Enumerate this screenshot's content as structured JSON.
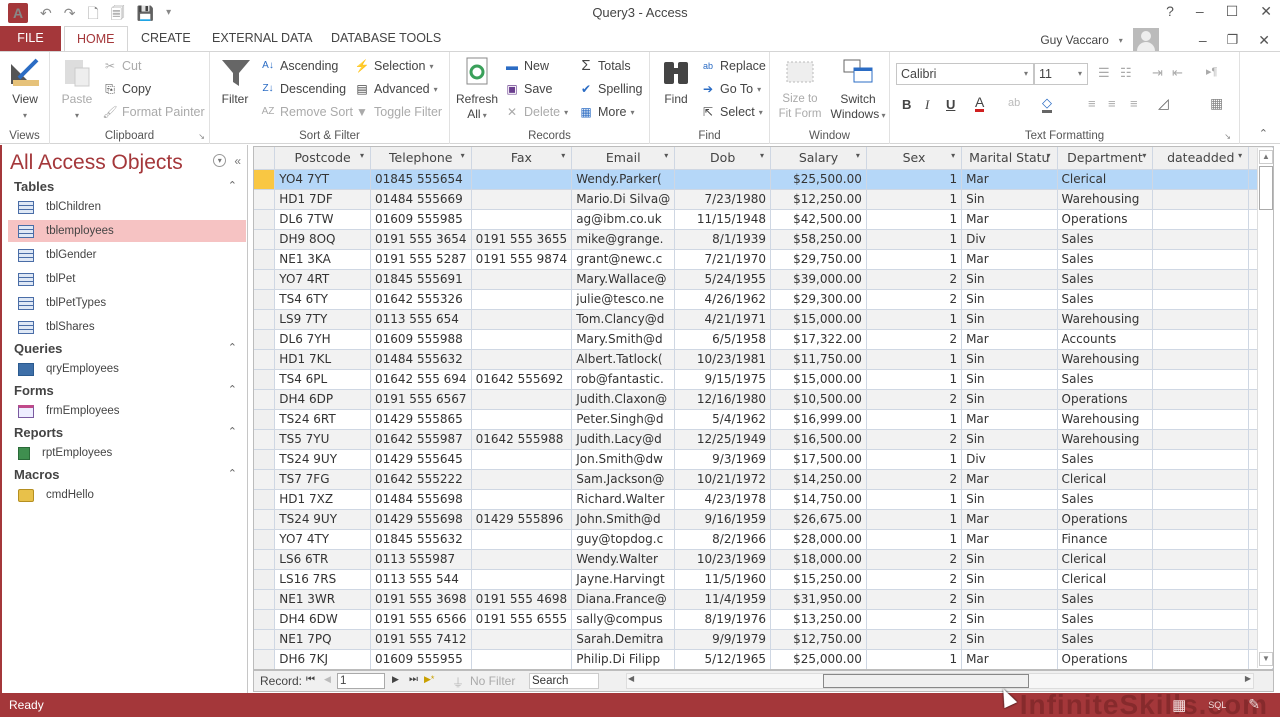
{
  "window": {
    "title": "Query3 - Access",
    "help": "?",
    "minimize": "–",
    "maximize": "☐",
    "close": "✕",
    "restore": "❐"
  },
  "qat": {
    "app_icon": "A",
    "undo": "↶",
    "redo": "↷",
    "print_preview": "🗋",
    "refresh": "🗐",
    "save": "💾",
    "customize": "▾"
  },
  "tabs": [
    {
      "label": "FILE"
    },
    {
      "label": "HOME"
    },
    {
      "label": "CREATE"
    },
    {
      "label": "EXTERNAL DATA"
    },
    {
      "label": "DATABASE TOOLS"
    }
  ],
  "user": {
    "name": "Guy Vaccaro",
    "caret": "▾"
  },
  "ribbon": {
    "views": {
      "label": "Views",
      "view": "View"
    },
    "clipboard": {
      "label": "Clipboard",
      "paste": "Paste",
      "cut": "Cut",
      "copy": "Copy",
      "format_painter": "Format Painter"
    },
    "sort_filter": {
      "label": "Sort & Filter",
      "filter": "Filter",
      "ascending": "Ascending",
      "descending": "Descending",
      "remove_sort": "Remove Sort",
      "selection": "Selection",
      "advanced": "Advanced",
      "toggle_filter": "Toggle Filter"
    },
    "records": {
      "label": "Records",
      "refresh": "Refresh",
      "refresh_all": "All",
      "new": "New",
      "save": "Save",
      "delete": "Delete",
      "totals": "Totals",
      "spelling": "Spelling",
      "more": "More"
    },
    "find": {
      "label": "Find",
      "find": "Find",
      "replace": "Replace",
      "goto": "Go To",
      "select": "Select"
    },
    "window": {
      "label": "Window",
      "size_to": "Size to",
      "fit_form": "Fit Form",
      "switch": "Switch",
      "windows": "Windows"
    },
    "text_formatting": {
      "label": "Text Formatting",
      "font": "Calibri",
      "size": "11",
      "bold": "B",
      "italic": "I",
      "underline": "U"
    }
  },
  "nav": {
    "title": "All Access Objects",
    "sections": [
      {
        "label": "Tables",
        "items": [
          "tblChildren",
          "tblemployees",
          "tblGender",
          "tblPet",
          "tblPetTypes",
          "tblShares"
        ]
      },
      {
        "label": "Queries",
        "items": [
          "qryEmployees"
        ]
      },
      {
        "label": "Forms",
        "items": [
          "frmEmployees"
        ]
      },
      {
        "label": "Reports",
        "items": [
          "rptEmployees"
        ]
      },
      {
        "label": "Macros",
        "items": [
          "cmdHello"
        ]
      }
    ],
    "selected": "tblemployees"
  },
  "table": {
    "columns": [
      "Postcode",
      "Telephone",
      "Fax",
      "Email",
      "Dob",
      "Salary",
      "Sex",
      "Marital Statu",
      "Department",
      "dateadded"
    ],
    "rows": [
      [
        "YO4 7YT",
        "01845 555654",
        "",
        "Wendy.Parker(",
        "",
        "$25,500.00",
        "1",
        "Mar",
        "Clerical",
        ""
      ],
      [
        "HD1 7DF",
        "01484 555669",
        "",
        "Mario.Di Silva@",
        "7/23/1980",
        "$12,250.00",
        "1",
        "Sin",
        "Warehousing",
        ""
      ],
      [
        "DL6 7TW",
        "01609 555985",
        "",
        "ag@ibm.co.uk",
        "11/15/1948",
        "$42,500.00",
        "1",
        "Mar",
        "Operations",
        ""
      ],
      [
        "DH9 8OQ",
        "0191 555 3654",
        "0191 555 3655",
        "mike@grange.",
        "8/1/1939",
        "$58,250.00",
        "1",
        "Div",
        "Sales",
        ""
      ],
      [
        "NE1 3KA",
        "0191 555 5287",
        "0191 555 9874",
        "grant@newc.c",
        "7/21/1970",
        "$29,750.00",
        "1",
        "Mar",
        "Sales",
        ""
      ],
      [
        "YO7 4RT",
        "01845 555691",
        "",
        "Mary.Wallace@",
        "5/24/1955",
        "$39,000.00",
        "2",
        "Sin",
        "Sales",
        ""
      ],
      [
        "TS4 6TY",
        "01642 555326",
        "",
        "julie@tesco.ne",
        "4/26/1962",
        "$29,300.00",
        "2",
        "Sin",
        "Sales",
        ""
      ],
      [
        "LS9 7TY",
        "0113 555 654",
        "",
        "Tom.Clancy@d",
        "4/21/1971",
        "$15,000.00",
        "1",
        "Sin",
        "Warehousing",
        ""
      ],
      [
        "DL6 7YH",
        "01609 555988",
        "",
        "Mary.Smith@d",
        "6/5/1958",
        "$17,322.00",
        "2",
        "Mar",
        "Accounts",
        ""
      ],
      [
        "HD1 7KL",
        "01484 555632",
        "",
        "Albert.Tatlock(",
        "10/23/1981",
        "$11,750.00",
        "1",
        "Sin",
        "Warehousing",
        ""
      ],
      [
        "TS4 6PL",
        "01642 555 694",
        "01642 555692",
        "rob@fantastic.",
        "9/15/1975",
        "$15,000.00",
        "1",
        "Sin",
        "Sales",
        ""
      ],
      [
        "DH4 6DP",
        "0191 555 6567",
        "",
        "Judith.Claxon@",
        "12/16/1980",
        "$10,500.00",
        "2",
        "Sin",
        "Operations",
        ""
      ],
      [
        "TS24 6RT",
        "01429 555865",
        "",
        "Peter.Singh@d",
        "5/4/1962",
        "$16,999.00",
        "1",
        "Mar",
        "Warehousing",
        ""
      ],
      [
        "TS5 7YU",
        "01642 555987",
        "01642 555988",
        "Judith.Lacy@d",
        "12/25/1949",
        "$16,500.00",
        "2",
        "Sin",
        "Warehousing",
        ""
      ],
      [
        "TS24 9UY",
        "01429 555645",
        "",
        "Jon.Smith@dw",
        "9/3/1969",
        "$17,500.00",
        "1",
        "Div",
        "Sales",
        ""
      ],
      [
        "TS7 7FG",
        "01642 555222",
        "",
        "Sam.Jackson@",
        "10/21/1972",
        "$14,250.00",
        "2",
        "Mar",
        "Clerical",
        ""
      ],
      [
        "HD1 7XZ",
        "01484 555698",
        "",
        "Richard.Walter",
        "4/23/1978",
        "$14,750.00",
        "1",
        "Sin",
        "Sales",
        ""
      ],
      [
        "TS24 9UY",
        "01429 555698",
        "01429 555896",
        "John.Smith@d",
        "9/16/1959",
        "$26,675.00",
        "1",
        "Mar",
        "Operations",
        ""
      ],
      [
        "YO7 4TY",
        "01845 555632",
        "",
        "guy@topdog.c",
        "8/2/1966",
        "$28,000.00",
        "1",
        "Mar",
        "Finance",
        ""
      ],
      [
        "LS6 6TR",
        "0113 555987",
        "",
        "Wendy.Walter",
        "10/23/1969",
        "$18,000.00",
        "2",
        "Sin",
        "Clerical",
        ""
      ],
      [
        "LS16 7RS",
        "0113 555 544",
        "",
        "Jayne.Harvingt",
        "11/5/1960",
        "$15,250.00",
        "2",
        "Sin",
        "Clerical",
        ""
      ],
      [
        "NE1 3WR",
        "0191 555 3698",
        "0191 555 4698",
        "Diana.France@",
        "11/4/1959",
        "$31,950.00",
        "2",
        "Sin",
        "Sales",
        ""
      ],
      [
        "DH4 6DW",
        "0191 555 6566",
        "0191 555 6555",
        "sally@compus",
        "8/19/1976",
        "$13,250.00",
        "2",
        "Sin",
        "Sales",
        ""
      ],
      [
        "NE1 7PQ",
        "0191 555 7412",
        "",
        "Sarah.Demitra",
        "9/9/1979",
        "$12,750.00",
        "2",
        "Sin",
        "Sales",
        ""
      ],
      [
        "DH6 7KJ",
        "01609 555955",
        "",
        "Philip.Di Filipp",
        "5/12/1965",
        "$25,000.00",
        "1",
        "Mar",
        "Operations",
        ""
      ]
    ]
  },
  "record_nav": {
    "label": "Record:",
    "current": "1",
    "first": "⏮",
    "prev": "◀",
    "next": "▶",
    "last": "⏭",
    "new": "▶*",
    "no_filter": "No Filter",
    "search_placeholder": "Search"
  },
  "status": {
    "text": "Ready",
    "watermark": "InfiniteSkills.com",
    "datasheet_view": "▦",
    "sql_view": "SQL",
    "design_view": "✎"
  }
}
